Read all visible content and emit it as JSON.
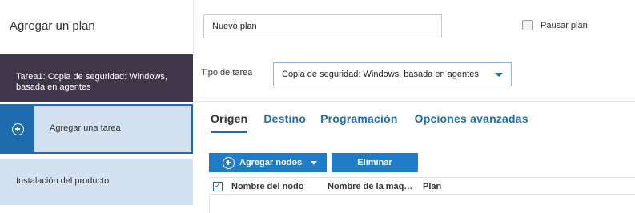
{
  "header": {
    "title": "Agregar un plan",
    "plan_name_value": "Nuevo plan",
    "pause_label": "Pausar plan"
  },
  "sidebar": {
    "task_label": "Tarea1: Copia de seguridad: Windows, basada en agentes",
    "add_task_label": "Agregar una tarea",
    "install_label": "Instalación del producto"
  },
  "main": {
    "task_type_label": "Tipo de tarea",
    "task_type_value": "Copia de seguridad: Windows, basada en agentes",
    "tabs": [
      "Origen",
      "Destino",
      "Programación",
      "Opciones avanzadas"
    ],
    "add_nodes_label": "Agregar nodos",
    "delete_label": "Eliminar",
    "columns": [
      "Nombre del nodo",
      "Nombre de la máq…",
      "Plan"
    ]
  },
  "colors": {
    "accent": "#1e6cae",
    "button": "#1e7cc9",
    "task_bg": "#3f3649",
    "panel_bg": "#d3e1f0"
  }
}
